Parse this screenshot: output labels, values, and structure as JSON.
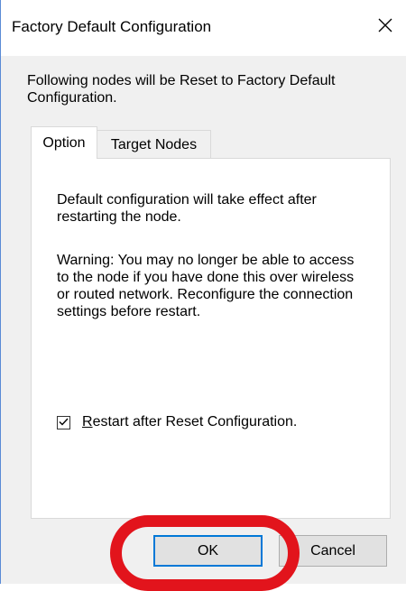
{
  "dialog": {
    "title": "Factory Default Configuration",
    "message": "Following nodes will be Reset to Factory Default Configuration."
  },
  "tabs": [
    {
      "label": "Option",
      "active": true
    },
    {
      "label": "Target Nodes",
      "active": false
    }
  ],
  "option_panel": {
    "info_text": "Default configuration will take effect after restarting the node.",
    "warning_text": "Warning: You may no longer be able to access to the node if you have done this over wireless or routed network. Reconfigure the connection settings before restart.",
    "restart_checkbox": {
      "label_hotkey": "R",
      "label_rest": "estart after Reset Configuration.",
      "checked": true
    }
  },
  "buttons": {
    "ok_label": "OK",
    "cancel_label": "Cancel"
  },
  "colors": {
    "highlight_ring": "#e2141c",
    "focus_border": "#0078d7"
  },
  "icons": {
    "close": "close-icon",
    "check": "checkmark-icon"
  }
}
